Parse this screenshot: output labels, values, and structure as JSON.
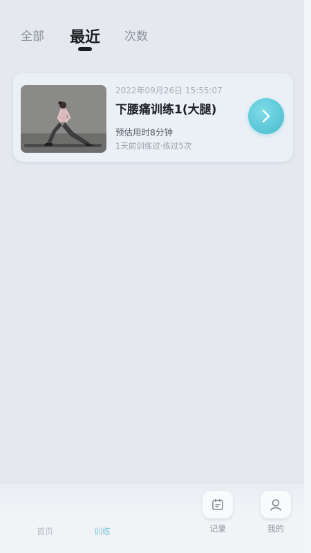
{
  "tabs": [
    {
      "label": "全部",
      "active": false
    },
    {
      "label": "最近",
      "active": true
    },
    {
      "label": "次数",
      "active": false
    }
  ],
  "card": {
    "date": "2022年09月26日 15:55:07",
    "title": "下腰痛训练1(大腿)",
    "duration": "预估用时8分钟",
    "history": "1天前训练过·练过5次",
    "thumbnail_icon": "kneeling-lunge-photo"
  },
  "bottom_nav": [
    {
      "label": "首页",
      "icon": "home-icon"
    },
    {
      "label": "训练",
      "icon": "training-icon",
      "active": true
    },
    {
      "label": "记录",
      "icon": "calendar-icon"
    },
    {
      "label": "我的",
      "icon": "user-icon"
    }
  ],
  "colors": {
    "background": "#e5e9ef",
    "accent": "#57c4d6",
    "active_tab_text": "#1c1e22"
  }
}
